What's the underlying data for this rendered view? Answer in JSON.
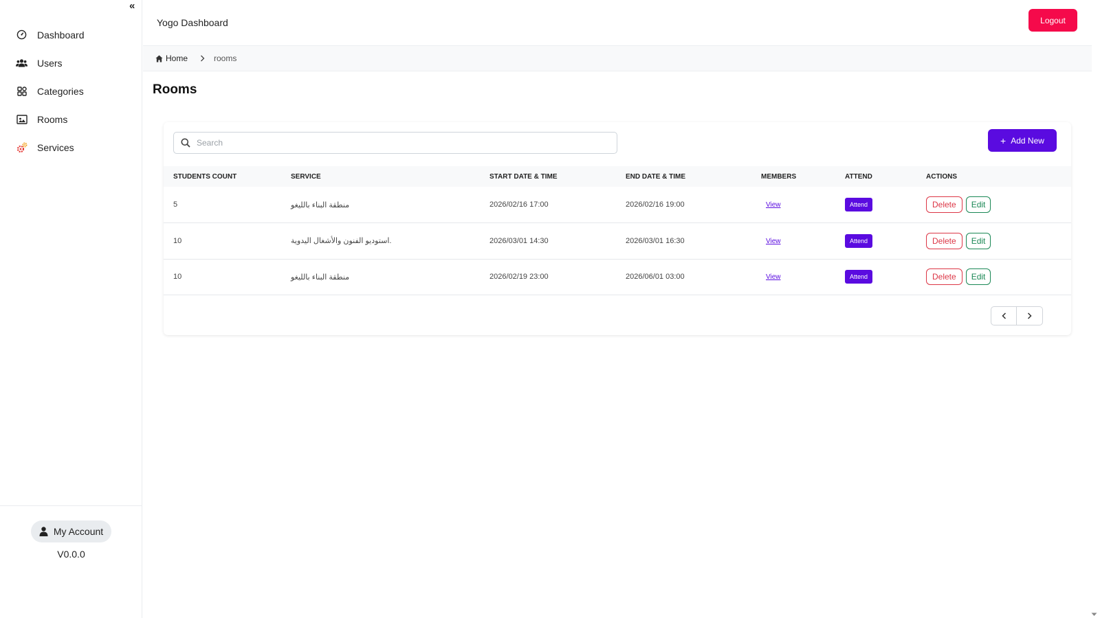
{
  "sidebar": {
    "items": [
      {
        "label": "Dashboard",
        "icon": "gauge-icon"
      },
      {
        "label": "Users",
        "icon": "users-icon"
      },
      {
        "label": "Categories",
        "icon": "grid-icon"
      },
      {
        "label": "Rooms",
        "icon": "room-icon"
      },
      {
        "label": "Services",
        "icon": "gears-icon"
      }
    ],
    "account_label": "My Account",
    "version": "V0.0.0"
  },
  "header": {
    "title": "Yogo Dashboard",
    "logout_label": "Logout"
  },
  "breadcrumb": {
    "home": "Home",
    "current": "rooms"
  },
  "page": {
    "title": "Rooms"
  },
  "toolbar": {
    "search_placeholder": "Search",
    "search_value": "",
    "add_label": "Add New"
  },
  "table": {
    "headers": [
      "STUDENTS COUNT",
      "SERVICE",
      "START DATE & TIME",
      "END DATE & TIME",
      "MEMBERS",
      "ATTEND",
      "ACTIONS"
    ],
    "rows": [
      {
        "students": "5",
        "service": "منطقة البناء بالليغو",
        "start": "2026/02/16 17:00",
        "end": "2026/02/16 19:00",
        "members": "View",
        "attend": "Attend",
        "delete": "Delete",
        "edit": "Edit"
      },
      {
        "students": "10",
        "service": "استوديو الفنون والأشغال اليدوية.",
        "start": "2026/03/01 14:30",
        "end": "2026/03/01 16:30",
        "members": "View",
        "attend": "Attend",
        "delete": "Delete",
        "edit": "Edit"
      },
      {
        "students": "10",
        "service": "منطقة البناء بالليغو",
        "start": "2026/02/19 23:00",
        "end": "2026/06/01 03:00",
        "members": "View",
        "attend": "Attend",
        "delete": "Delete",
        "edit": "Edit"
      }
    ]
  },
  "colors": {
    "primary": "#5a0be0",
    "logout": "#f50a4b",
    "delete": "#dc3545",
    "edit": "#198754"
  }
}
